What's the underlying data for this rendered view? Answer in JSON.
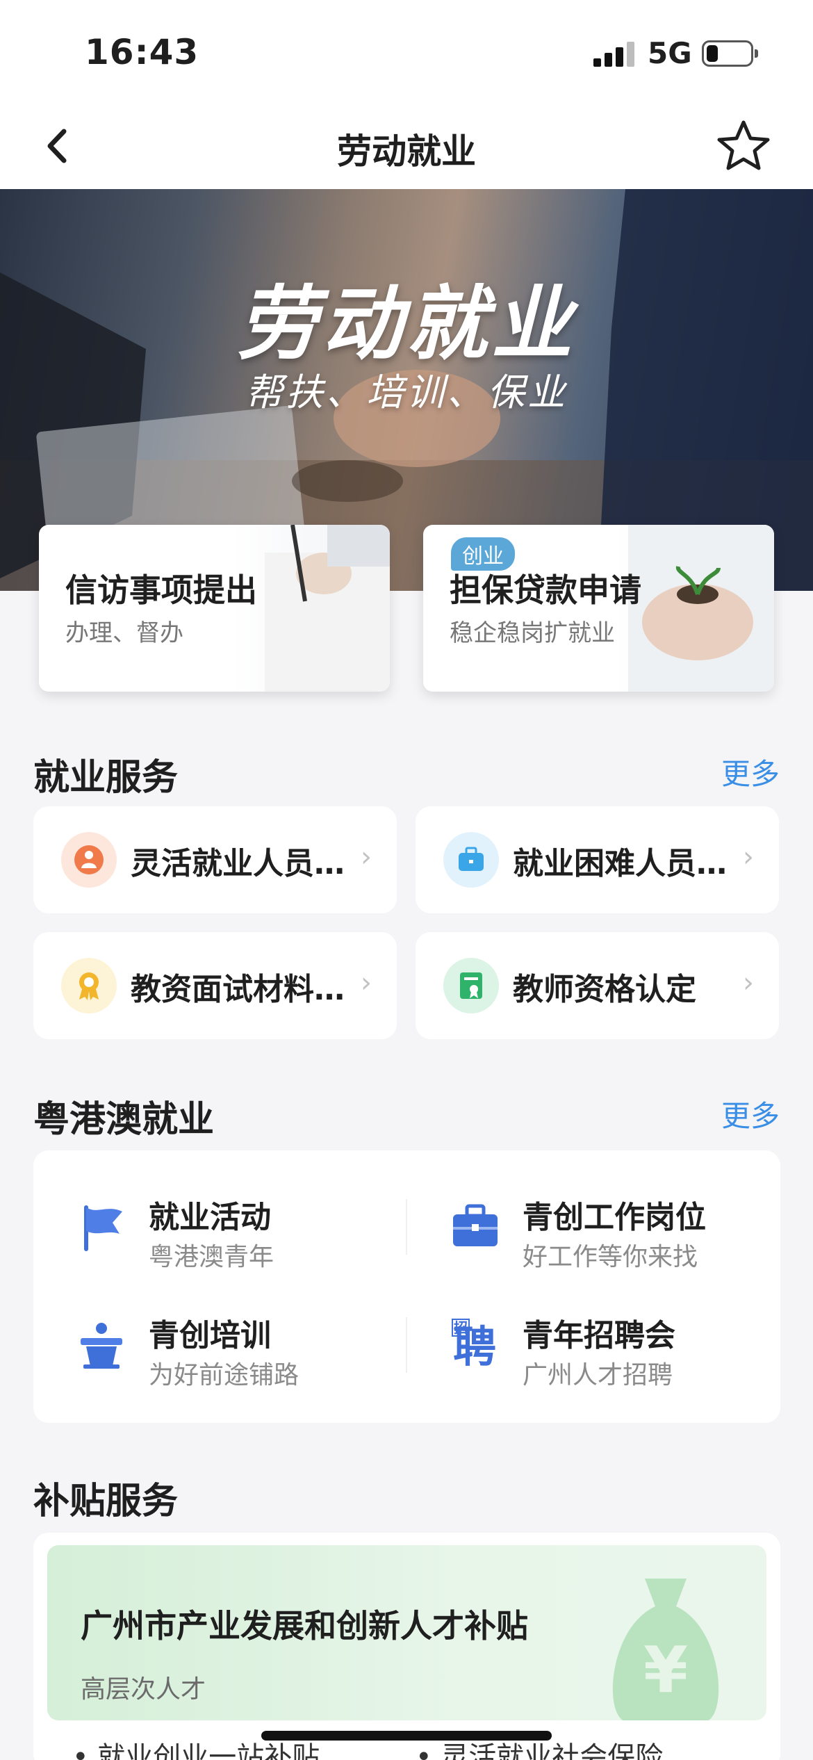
{
  "status_bar": {
    "time": "16:43",
    "network": "5G",
    "battery_level": 0.25
  },
  "nav": {
    "title": "劳动就业",
    "back_icon": "chevron-left-icon",
    "favorite_icon": "star-outline-icon"
  },
  "banner": {
    "title": "劳动就业",
    "subtitle": "帮扶、培训、保业"
  },
  "quick_cards": [
    {
      "title": "信访事项提出",
      "subtitle": "办理、督办",
      "badge": ""
    },
    {
      "title": "担保贷款申请",
      "subtitle": "稳企稳岗扩就业",
      "badge": "创业"
    }
  ],
  "employment_services": {
    "title": "就业服务",
    "more": "更多",
    "items": [
      {
        "label": "灵活就业人员…",
        "icon": "flexible-workers-icon",
        "color": "#f07a4a"
      },
      {
        "label": "就业困难人员…",
        "icon": "briefcase-icon",
        "color": "#3aa6e8"
      },
      {
        "label": "教资面试材料…",
        "icon": "award-ribbon-icon",
        "color": "#f2b52b"
      },
      {
        "label": "教师资格认定",
        "icon": "certificate-icon",
        "color": "#2fb36b"
      }
    ]
  },
  "gba_employment": {
    "title": "粤港澳就业",
    "more": "更多",
    "items": [
      {
        "title": "就业活动",
        "subtitle": "粤港澳青年",
        "icon": "flag-icon"
      },
      {
        "title": "青创工作岗位",
        "subtitle": "好工作等你来找",
        "icon": "briefcase-icon"
      },
      {
        "title": "青创培训",
        "subtitle": "为好前途铺路",
        "icon": "podium-icon"
      },
      {
        "title": "青年招聘会",
        "subtitle": "广州人才招聘",
        "icon": "recruit-icon"
      }
    ],
    "recruit_glyph_top": "招",
    "recruit_glyph": "聘"
  },
  "subsidy": {
    "title": "补贴服务",
    "card_title": "广州市产业发展和创新人才补贴",
    "card_subtitle": "高层次人才",
    "bag_glyph": "¥",
    "bullets": [
      "就业创业一站补贴",
      "灵活就业社会保险"
    ]
  },
  "colors": {
    "accent": "#3a8ee6",
    "gba_icon": "#3f6fd8",
    "subsidy_bg": "#e3f4e6"
  }
}
